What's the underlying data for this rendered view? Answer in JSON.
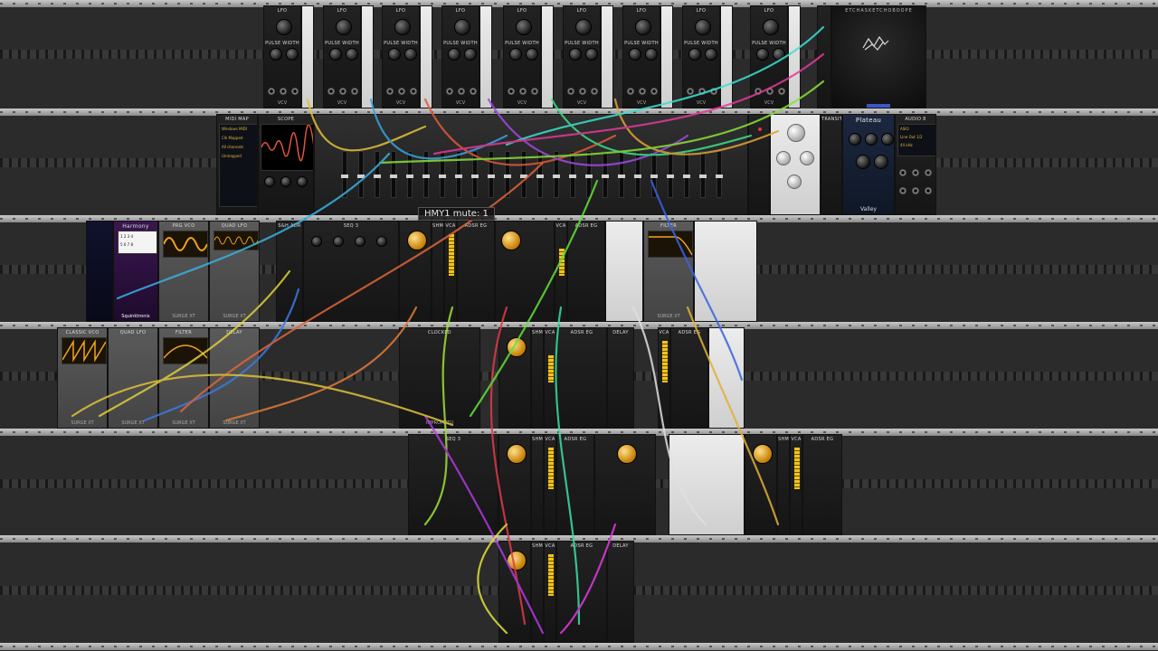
{
  "tooltip": "HMY1 mute: 1",
  "modules": {
    "lfo_title": "LFO",
    "lfo_pulse_width": "PULSE WIDTH",
    "brand_vcv": "VCV",
    "midi_map": "MIDI MAP",
    "midi_map_rows": [
      "Windows MIDI",
      "Clk Mapped",
      "All channels",
      "Unmapped"
    ],
    "scope": "SCOPE",
    "audio_8": "AUDIO 8",
    "audio_rows": [
      "ASIO",
      "Line Out 1/2",
      "44 kHz"
    ],
    "plateau": "Plateau",
    "valley": "Valley",
    "transit": "TRANSIT",
    "harmony": "Harmony",
    "harmony_screen": [
      "1 2 3 4",
      "5  6  7  8"
    ],
    "squinktronix": "Squinktronix",
    "prg_vco": "PRG VCO",
    "quad_lfo": "QUAD LFO",
    "classic_vco": "CLASSIC VCO",
    "filter": "FILTER",
    "delay": "DELAY",
    "sh_adr": "S&H ADR",
    "seq3": "SEQ 3",
    "vca": "VCA",
    "adsr_eg": "ADSR EG",
    "shimmer": "SHMT",
    "clocked": "CLOCKED",
    "impromptu": "IMPROMPTU",
    "surge_xt": "SURGE XT",
    "etched_banner": "ETCHASKETCHOBOOPE"
  },
  "colors": {
    "rack_bg": "#2b2b2b",
    "rail": "#b0b0b0",
    "accent_yellow": "#f2c31b",
    "tooltip_bg": "#141414"
  }
}
